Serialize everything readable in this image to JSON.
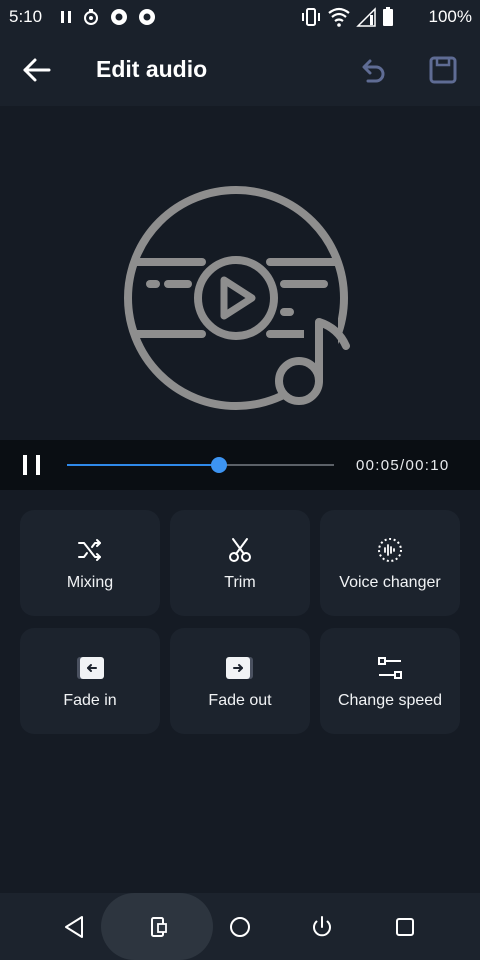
{
  "status_bar": {
    "time": "5:10",
    "battery_percent": "100%",
    "icons": [
      "pause-icon",
      "notification-icon",
      "app-icon",
      "app-icon",
      "vibrate-icon",
      "wifi-icon",
      "signal-icon",
      "battery-icon"
    ]
  },
  "app_bar": {
    "title": "Edit audio",
    "icons": [
      "back-arrow-icon",
      "undo-icon",
      "save-icon"
    ]
  },
  "player": {
    "time_display": "00:05/00:10",
    "progress_fraction": 0.57,
    "icons": [
      "pause-icon"
    ]
  },
  "tools": [
    {
      "label": "Mixing",
      "icon": "shuffle-icon"
    },
    {
      "label": "Trim",
      "icon": "scissors-icon"
    },
    {
      "label": "Voice changer",
      "icon": "voice-changer-icon"
    },
    {
      "label": "Fade in",
      "icon": "fade-in-icon"
    },
    {
      "label": "Fade out",
      "icon": "fade-out-icon"
    },
    {
      "label": "Change speed",
      "icon": "sliders-icon"
    }
  ],
  "nav_bar": {
    "icons": [
      "back-triangle-icon",
      "screen-rotate-icon",
      "home-circle-icon",
      "power-icon",
      "recents-square-icon"
    ]
  },
  "colors": {
    "background": "#151b24",
    "accent": "#2f89ea",
    "tile": "#1c232d",
    "artwork": "#8e8e8e",
    "inactive_icon": "#5f6c94"
  }
}
